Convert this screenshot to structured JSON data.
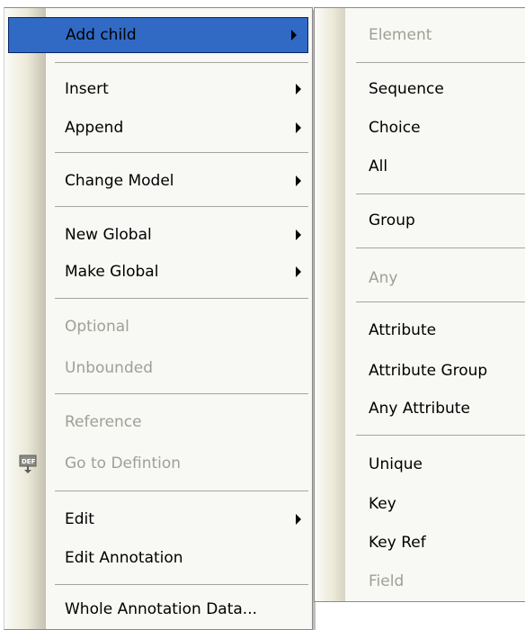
{
  "main_menu": {
    "items": [
      {
        "label": "Add child",
        "has_arrow": true,
        "disabled": false,
        "highlighted": true
      },
      {
        "label": "Insert",
        "has_arrow": true,
        "disabled": false
      },
      {
        "label": "Append",
        "has_arrow": true,
        "disabled": false
      },
      {
        "label": "Change Model",
        "has_arrow": true,
        "disabled": false
      },
      {
        "label": "New Global",
        "has_arrow": true,
        "disabled": false
      },
      {
        "label": "Make Global",
        "has_arrow": true,
        "disabled": false
      },
      {
        "label": "Optional",
        "has_arrow": false,
        "disabled": true
      },
      {
        "label": "Unbounded",
        "has_arrow": false,
        "disabled": true
      },
      {
        "label": "Reference",
        "has_arrow": false,
        "disabled": true
      },
      {
        "label": "Go to Defintion",
        "has_arrow": false,
        "disabled": true,
        "icon": "def-icon"
      },
      {
        "label": "Edit",
        "has_arrow": true,
        "disabled": false
      },
      {
        "label": "Edit Annotation",
        "has_arrow": false,
        "disabled": false
      },
      {
        "label": "Whole Annotation Data...",
        "has_arrow": false,
        "disabled": false
      }
    ]
  },
  "sub_menu": {
    "items": [
      {
        "label": "Element",
        "disabled": true
      },
      {
        "label": "Sequence",
        "disabled": false
      },
      {
        "label": "Choice",
        "disabled": false
      },
      {
        "label": "All",
        "disabled": false
      },
      {
        "label": "Group",
        "disabled": false
      },
      {
        "label": "Any",
        "disabled": true
      },
      {
        "label": "Attribute",
        "disabled": false
      },
      {
        "label": "Attribute Group",
        "disabled": false
      },
      {
        "label": "Any Attribute",
        "disabled": false
      },
      {
        "label": "Unique",
        "disabled": false
      },
      {
        "label": "Key",
        "disabled": false
      },
      {
        "label": "Key Ref",
        "disabled": false
      },
      {
        "label": "Field",
        "disabled": true
      }
    ]
  },
  "colors": {
    "highlight": "#316ac5",
    "disabled_text": "#a09f96",
    "menu_bg": "#f8f8f4"
  }
}
